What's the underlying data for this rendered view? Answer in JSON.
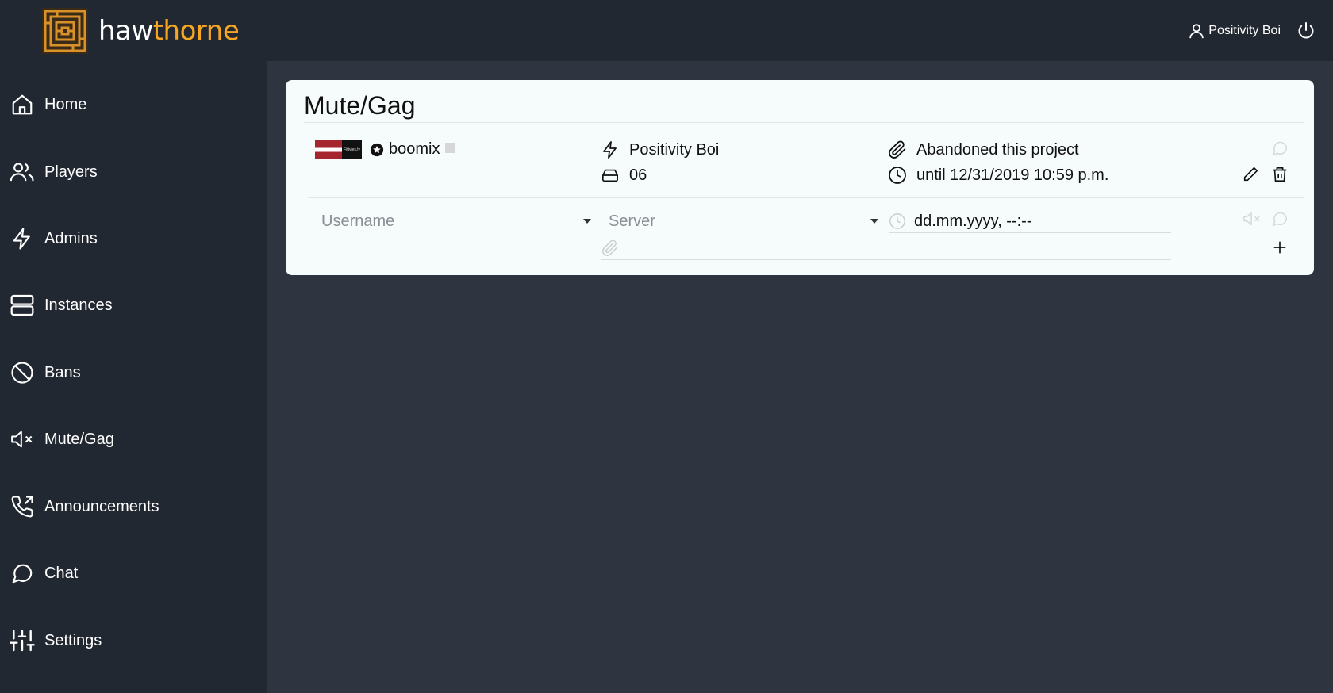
{
  "brand": {
    "part1": "haw",
    "part2": "thorne",
    "accent": "#f5a623"
  },
  "header": {
    "user_name": "Positivity Boi",
    "user_icon": "user-icon",
    "logout_icon": "power-icon"
  },
  "sidebar": {
    "items": [
      {
        "label": "Home",
        "icon": "home-icon"
      },
      {
        "label": "Players",
        "icon": "users-icon"
      },
      {
        "label": "Admins",
        "icon": "lightning-icon"
      },
      {
        "label": "Instances",
        "icon": "server-icon"
      },
      {
        "label": "Bans",
        "icon": "ban-icon"
      },
      {
        "label": "Mute/Gag",
        "icon": "mute-icon"
      },
      {
        "label": "Announcements",
        "icon": "phone-outgoing-icon"
      },
      {
        "label": "Chat",
        "icon": "chat-icon"
      },
      {
        "label": "Settings",
        "icon": "sliders-icon"
      }
    ]
  },
  "page": {
    "title": "Mute/Gag"
  },
  "entry": {
    "player_name": "boomix",
    "admin_name": "Positivity Boi",
    "server": "06",
    "reason": "Abandoned this project",
    "expires": "until 12/31/2019 10:59 p.m.",
    "server_badge_text": "Fittyies.lv"
  },
  "form": {
    "username_placeholder": "Username",
    "server_placeholder": "Server",
    "date_value": "dd.mm.yyyy, --:--"
  }
}
